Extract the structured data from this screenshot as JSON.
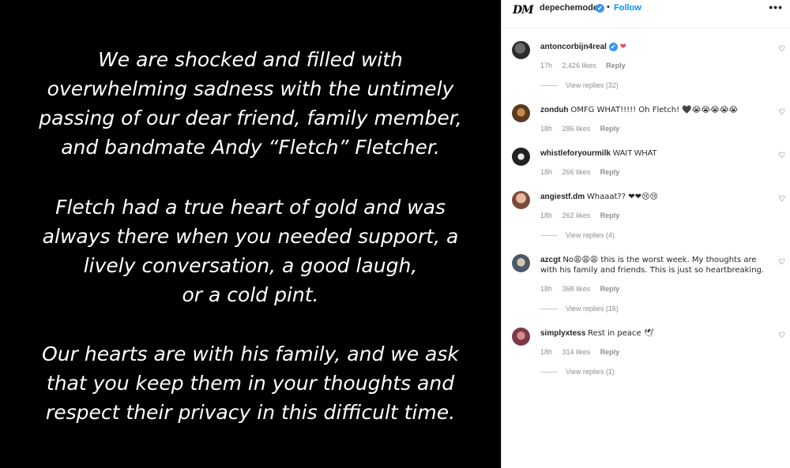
{
  "post": {
    "paragraphs": [
      [
        "We are shocked and filled with",
        "overwhelming sadness with the untimely",
        "passing of our dear friend, family member,",
        "and bandmate Andy “Fletch” Fletcher."
      ],
      [
        "Fletch had a true heart of gold and was",
        "always there when you needed support, a",
        "lively conversation, a good laugh,",
        "or a cold pint."
      ],
      [
        "Our hearts are with his family, and we ask",
        "that you keep them in your thoughts and",
        "respect their privacy in this difficult time."
      ]
    ]
  },
  "header": {
    "logo": "DM",
    "account": "depechemode",
    "verified_icon": "✔",
    "separator": "•",
    "follow_label": "Follow",
    "more_icon": "•••"
  },
  "comments": [
    {
      "user": "antoncorbijn4real",
      "verified": "✔",
      "text": " ❤",
      "time": "17h",
      "likes": "2,426 likes",
      "reply": "Reply",
      "view_replies": "View replies (32)"
    },
    {
      "user": "zonduh",
      "text": "OMFG WHAT!!!!! Oh Fletch! 🖤😭😭😭😭😭",
      "time": "18h",
      "likes": "286 likes",
      "reply": "Reply",
      "view_replies": ""
    },
    {
      "user": "whistleforyourmilk",
      "text": "WAIT WHAT",
      "time": "18h",
      "likes": "266 likes",
      "reply": "Reply",
      "view_replies": ""
    },
    {
      "user": "angiestf.dm",
      "text": "Whaaat?? ❤❤😢😢",
      "time": "18h",
      "likes": "262 likes",
      "reply": "Reply",
      "view_replies": "View replies (4)"
    },
    {
      "user": "azcgt",
      "text": "No😩😩😩 this is the worst week. My thoughts are with his family and friends. This is just so heartbreaking.",
      "time": "18h",
      "likes": "368 likes",
      "reply": "Reply",
      "view_replies": "View replies (16)"
    },
    {
      "user": "simplyxtess",
      "text": "Rest in peace 🕊",
      "time": "18h",
      "likes": "314 likes",
      "reply": "Reply",
      "view_replies": "View replies (1)"
    }
  ],
  "like_icon": "♡"
}
